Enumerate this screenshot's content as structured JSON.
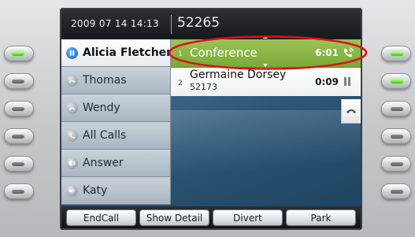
{
  "header": {
    "datetime": "2009 07 14 14:13",
    "extension": "52265"
  },
  "lines": [
    {
      "label": "Alicia Fletcher",
      "icon": "pause-icon",
      "active": true
    },
    {
      "label": "Thomas",
      "icon": "handset-icon",
      "active": false
    },
    {
      "label": "Wendy",
      "icon": "handset-icon",
      "active": false
    },
    {
      "label": "All Calls",
      "icon": "all-calls-icon",
      "active": false
    },
    {
      "label": "Answer",
      "icon": "answer-icon",
      "active": false
    },
    {
      "label": "Katy",
      "icon": "intercom-icon",
      "active": false
    }
  ],
  "calls": [
    {
      "index": "1",
      "name": "Conference",
      "timer": "6:01",
      "state_icon": "connected-call-icon"
    },
    {
      "index": "2",
      "name": "Germaine Dorsey",
      "number": "52173",
      "timer": "0:09",
      "state_icon": "hold-icon"
    }
  ],
  "softkeys": [
    "EndCall",
    "Show Detail",
    "Divert",
    "Park"
  ],
  "leds": {
    "left": [
      "on",
      "off",
      "off",
      "off",
      "off",
      "off"
    ],
    "right": [
      "on",
      "on",
      "off",
      "off",
      "off",
      "off"
    ]
  },
  "colors": {
    "active_call": "#8bb747",
    "led_on": "#35c11d",
    "highlight": "#e0101a",
    "screen_bg": "#2c5777"
  }
}
